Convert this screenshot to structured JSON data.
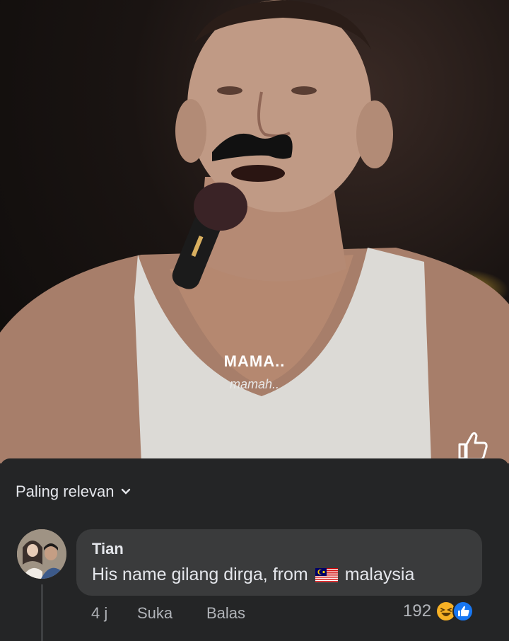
{
  "video": {
    "caption_main": "MAMA..",
    "caption_sub": "mamah.."
  },
  "comments": {
    "sort_label": "Paling relevan",
    "items": [
      {
        "author": "Tian",
        "text_before": "His name gilang dirga, from",
        "flag_icon": "malaysia-flag-icon",
        "text_after": "malaysia",
        "time": "4 j",
        "like_label": "Suka",
        "reply_label": "Balas",
        "reaction_count": "192",
        "reaction_icons": [
          "haha-icon",
          "like-icon"
        ]
      }
    ]
  },
  "colors": {
    "panel_bg": "#242526",
    "bubble_bg": "#3a3b3c",
    "text_primary": "#e4e6eb",
    "text_secondary": "#b0b3b8",
    "like_blue": "#1877f2",
    "haha_yellow": "#f7b125"
  }
}
